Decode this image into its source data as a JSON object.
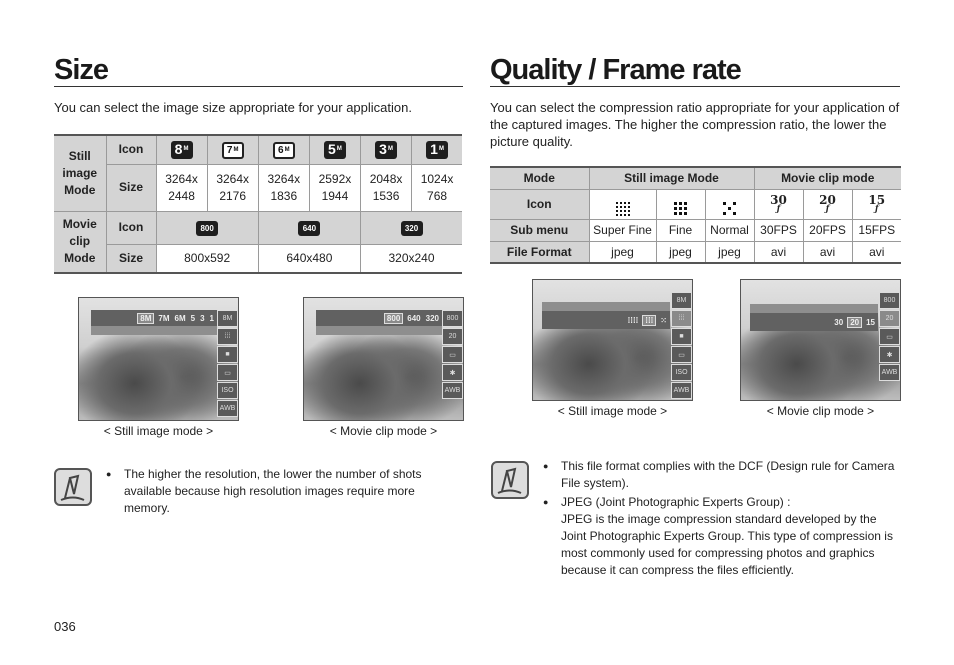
{
  "left": {
    "title": "Size",
    "intro": "You can select the image size appropriate for your application.",
    "table": {
      "still": {
        "group_label": "Still image Mode",
        "icon_label": "Icon",
        "size_label": "Size",
        "icons": [
          "8M",
          "7M",
          "6M",
          "5M",
          "3M",
          "1M"
        ],
        "sizes": [
          [
            "3264x",
            "2448"
          ],
          [
            "3264x",
            "2176"
          ],
          [
            "3264x",
            "1836"
          ],
          [
            "2592x",
            "1944"
          ],
          [
            "2048x",
            "1536"
          ],
          [
            "1024x",
            "768"
          ]
        ]
      },
      "movie": {
        "group_label": "Movie clip Mode",
        "icon_label": "Icon",
        "size_label": "Size",
        "icons": [
          "800",
          "640",
          "320"
        ],
        "sizes": [
          "800x592",
          "640x480",
          "320x240"
        ]
      }
    },
    "screens": [
      {
        "caption": "< Still image mode >",
        "menu_items": [
          "8M",
          "7M",
          "6M",
          "5",
          "3",
          "1"
        ],
        "selected": "8M",
        "side_top": "8M"
      },
      {
        "caption": "< Movie clip mode >",
        "menu_items": [
          "800",
          "640",
          "320"
        ],
        "selected": "800",
        "side_top": "800"
      }
    ],
    "note": [
      "The higher the resolution, the lower the number of shots available because high resolution images require more memory."
    ]
  },
  "right": {
    "title": "Quality / Frame rate",
    "intro": "You can select the compression ratio appropriate for your application of the captured images. The higher the compression ratio, the lower the picture quality.",
    "table": {
      "header": {
        "mode": "Mode",
        "still": "Still image Mode",
        "movie": "Movie clip mode"
      },
      "icon_label": "Icon",
      "submenu_label": "Sub menu",
      "format_label": "File Format",
      "icons": [
        "super-fine",
        "fine",
        "normal",
        "30fps",
        "20fps",
        "15fps"
      ],
      "fps_numbers": [
        "30",
        "20",
        "15"
      ],
      "submenus": [
        "Super Fine",
        "Fine",
        "Normal",
        "30FPS",
        "20FPS",
        "15FPS"
      ],
      "formats": [
        "jpeg",
        "jpeg",
        "jpeg",
        "avi",
        "avi",
        "avi"
      ]
    },
    "screens": [
      {
        "caption": "< Still image mode >",
        "side_top": "8M"
      },
      {
        "caption": "< Movie clip mode >",
        "side_top": "800",
        "menu_items": [
          "30",
          "20",
          "15"
        ],
        "selected": "20"
      }
    ],
    "note": [
      "This file format complies with the DCF (Design rule for Camera File system).",
      "JPEG (Joint Photographic Experts Group) :",
      "JPEG is the image compression standard developed by the Joint Photographic Experts Group. This type of compression is most commonly used for compressing photos and graphics because it can compress the files efficiently."
    ]
  },
  "page_number": "036"
}
